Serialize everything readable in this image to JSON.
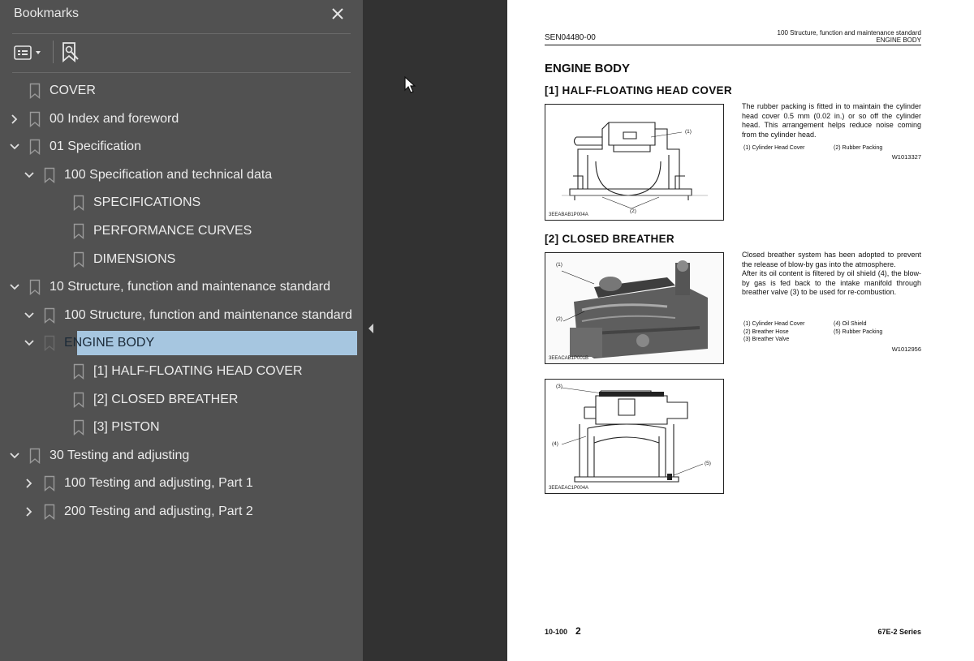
{
  "bookmarks_panel": {
    "title": "Bookmarks",
    "items": [
      {
        "label": "COVER",
        "expander": "none"
      },
      {
        "label": "00 Index and foreword",
        "expander": "collapsed"
      },
      {
        "label": "01 Specification",
        "expander": "expanded"
      },
      {
        "label": "100 Specification and technical data",
        "expander": "expanded"
      },
      {
        "label": "SPECIFICATIONS",
        "expander": "none"
      },
      {
        "label": "PERFORMANCE CURVES",
        "expander": "none"
      },
      {
        "label": "DIMENSIONS",
        "expander": "none"
      },
      {
        "label": "10 Structure, function and maintenance standard",
        "expander": "expanded"
      },
      {
        "label": "100 Structure, function and maintenance standard",
        "expander": "expanded"
      },
      {
        "label": "ENGINE BODY",
        "expander": "expanded",
        "selected": true
      },
      {
        "label": "[1] HALF-FLOATING HEAD COVER",
        "expander": "none"
      },
      {
        "label": "[2] CLOSED BREATHER",
        "expander": "none"
      },
      {
        "label": "[3] PISTON",
        "expander": "none"
      },
      {
        "label": "30 Testing and adjusting",
        "expander": "expanded"
      },
      {
        "label": "100 Testing and adjusting, Part 1",
        "expander": "collapsed"
      },
      {
        "label": "200 Testing and adjusting, Part 2",
        "expander": "collapsed"
      }
    ],
    "icons": [
      "close-icon",
      "options-menu-icon",
      "find-bookmark-icon",
      "bookmark-icon",
      "chevron-right-icon",
      "chevron-down-icon"
    ],
    "colors": {
      "panel_bg": "#515151",
      "selection": "#a6c6e0"
    }
  },
  "page": {
    "header": {
      "doc_code": "SEN04480-00",
      "right_line1": "100 Structure, function and maintenance standard",
      "right_line2": "ENGINE BODY"
    },
    "title": "ENGINE BODY",
    "section1": {
      "title": "[1]  HALF-FLOATING HEAD COVER",
      "text": "The rubber packing is fitted in to maintain the cylinder head cover 0.5 mm (0.02 in.) or so off the cylinder head.  This arrangement helps reduce noise coming from the cylinder head.",
      "legend": [
        "(1)  Cylinder Head Cover",
        "(2)  Rubber Packing"
      ],
      "code": "W1013327",
      "figure": {
        "code": "3EEABAB1P004A",
        "callouts": [
          "(1)",
          "(2)"
        ]
      }
    },
    "section2": {
      "title": "[2]  CLOSED  BREATHER",
      "text": "Closed breather system has been adopted to prevent the release of blow-by gas into the atmosphere.\nAfter its oil content is filtered by oil shield (4), the blow-by gas is fed back to the intake manifold through breather valve (3) to be used for re-combustion.",
      "legend": [
        "(1)  Cylinder Head Cover",
        "(2)  Breather Hose",
        "(3)  Breather Valve",
        "(4)  Oil Shield",
        "(5)  Rubber Packing"
      ],
      "code": "W1012956",
      "figure_photo": {
        "code": "3EEACAB1P001B",
        "callouts": [
          "(1)",
          "(2)"
        ]
      },
      "figure_section": {
        "code": "3EEAEAC1P004A",
        "callouts": [
          "(3)",
          "(4)",
          "(5)"
        ]
      }
    },
    "footer": {
      "left": "10-100",
      "page_num": "2",
      "right": "67E-2 Series"
    }
  }
}
